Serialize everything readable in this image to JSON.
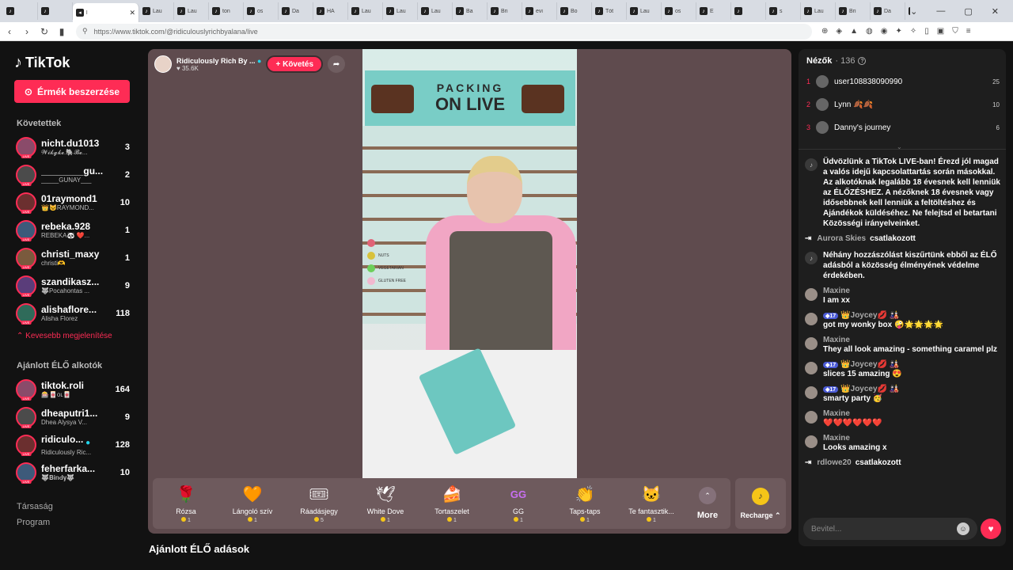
{
  "browser": {
    "tabs": [
      {
        "title": "",
        "icon": "tiktok-icon"
      },
      {
        "title": "",
        "icon": "tiktok-icon"
      },
      {
        "title": "l",
        "icon": "speaker-icon",
        "active": true
      },
      {
        "title": "Lau",
        "icon": "tiktok-icon"
      },
      {
        "title": "Lau",
        "icon": "tiktok-icon"
      },
      {
        "title": "ton",
        "icon": "tiktok-icon"
      },
      {
        "title": "os",
        "icon": "tiktok-icon"
      },
      {
        "title": "Da",
        "icon": "tiktok-icon"
      },
      {
        "title": "HA",
        "icon": "tiktok-icon"
      },
      {
        "title": "Lau",
        "icon": "tiktok-icon"
      },
      {
        "title": "Lau",
        "icon": "tiktok-icon"
      },
      {
        "title": "Lau",
        "icon": "tiktok-icon"
      },
      {
        "title": "Ba",
        "icon": "tiktok-icon"
      },
      {
        "title": "Bri",
        "icon": "tiktok-icon"
      },
      {
        "title": "evi",
        "icon": "tiktok-icon"
      },
      {
        "title": "Bo",
        "icon": "tiktok-icon"
      },
      {
        "title": "Tót",
        "icon": "tiktok-icon"
      },
      {
        "title": "Lau",
        "icon": "tiktok-icon"
      },
      {
        "title": "os",
        "icon": "tiktok-icon"
      },
      {
        "title": "E",
        "icon": "tiktok-icon"
      },
      {
        "title": "",
        "icon": "tiktok-icon"
      },
      {
        "title": "s",
        "icon": "tiktok-icon"
      },
      {
        "title": "Lau",
        "icon": "tiktok-icon"
      },
      {
        "title": "Bri",
        "icon": "tiktok-icon"
      },
      {
        "title": "Da",
        "icon": "tiktok-icon"
      },
      {
        "title": "net",
        "icon": "tiktok-icon"
      }
    ],
    "url": "https://www.tiktok.com/@ridiculouslyrichbyalana/live"
  },
  "sidebar": {
    "logo": "TikTok",
    "coins_button": "Érmék beszerzése",
    "following_title": "Követettek",
    "following": [
      {
        "name": "nicht.du1013",
        "sub": "𝓦𝓲𝓴𝓰𝓴𝓮.🐘𝓑𝓮...",
        "count": "3"
      },
      {
        "name": "________gu...",
        "sub": "_____GUNAY___",
        "count": "2"
      },
      {
        "name": "01raymond1",
        "sub": "👑😺RAYMOND...",
        "count": "10"
      },
      {
        "name": "rebeka.928",
        "sub": "REBEKA🐼 ❤️...",
        "count": "1"
      },
      {
        "name": "christi_maxy",
        "sub": "christi🫶",
        "count": "1"
      },
      {
        "name": "szandikasz...",
        "sub": "🐺Pocahontas ...",
        "count": "9"
      },
      {
        "name": "alishaflore...",
        "sub": "Alisha Florez",
        "count": "118"
      }
    ],
    "show_less": "Kevesebb megjelenítése",
    "recommended_title": "Ajánlott ÉLŐ alkotók",
    "recommended": [
      {
        "name": "tiktok.roli",
        "sub": "🎰🀄ᴏʟ🀄",
        "count": "164"
      },
      {
        "name": "dheaputri1...",
        "sub": "Dhea Alysya V...",
        "count": "9"
      },
      {
        "name": "ridiculo...",
        "sub": "Ridiculously Ric...",
        "count": "128",
        "verified": true
      },
      {
        "name": "feherfarka...",
        "sub": "🐺𝐁𝐢𝐧𝐝𝐲🐺",
        "count": "10"
      }
    ],
    "footer_links": [
      "Társaság",
      "Program"
    ]
  },
  "player": {
    "host_name": "Ridiculously Rich By ...",
    "host_likes": "35.6K",
    "follow_label": "+ Követés",
    "video_banner_line1": "PACKING",
    "video_banner_line2": "ON LIVE",
    "allergens": [
      "NUTS",
      "VEGETARIAN",
      "GLUTEN FREE"
    ],
    "gifts": [
      {
        "name": "Rózsa",
        "price": "1",
        "icon": "rose-icon",
        "glyph": "🌹"
      },
      {
        "name": "Lángoló szív",
        "price": "1",
        "icon": "heart-icon",
        "glyph": "🧡"
      },
      {
        "name": "Ráadásjegy",
        "price": "5",
        "icon": "ticket-icon",
        "glyph": "🎟"
      },
      {
        "name": "White Dove",
        "price": "1",
        "icon": "dove-icon",
        "glyph": "🕊"
      },
      {
        "name": "Tortaszelet",
        "price": "1",
        "icon": "cake-icon",
        "glyph": "🍰"
      },
      {
        "name": "GG",
        "price": "1",
        "icon": "gg-icon",
        "glyph": "GG"
      },
      {
        "name": "Taps-taps",
        "price": "1",
        "icon": "clap-icon",
        "glyph": "👏"
      },
      {
        "name": "Te fantasztik...",
        "price": "1",
        "icon": "cat-icon",
        "glyph": "🐱"
      }
    ],
    "more_label": "More",
    "recharge_label": "Recharge"
  },
  "below_title": "Ajánlott ÉLŐ adások",
  "right": {
    "viewers_label": "Nézők",
    "viewers_count": "· 136",
    "top_viewers": [
      {
        "rank": "1",
        "name": "user108838090990",
        "score": "25"
      },
      {
        "rank": "2",
        "name": "Lynn 🍂🍂",
        "score": "10"
      },
      {
        "rank": "3",
        "name": "Danny's journey",
        "score": "6"
      }
    ],
    "chat": [
      {
        "type": "system",
        "text": "Üdvözlünk a TikTok LIVE-ban! Érezd jól magad a valós idejű kapcsolattartás során másokkal. Az alkotóknak legalább 18 évesnek kell lenniük az ÉLŐZÉSHEZ. A nézőknek 18 évesnek vagy idősebbnek kell lenniük a feltöltéshez és Ajándékok küldéséhez. Ne felejtsd el betartani Közösségi irányelveinket."
      },
      {
        "type": "join",
        "user": "Aurora Skies",
        "text": "csatlakozott"
      },
      {
        "type": "system",
        "text": "Néhány hozzászólást kiszűrtünk ebből az ÉLŐ adásból a közösség élményének védelme érdekében."
      },
      {
        "type": "msg",
        "user": "Maxine",
        "level": "",
        "text": "I am xx"
      },
      {
        "type": "msg",
        "user": "👑Joycey💋 🎎",
        "level": "17",
        "text": "got my wonky box 🤪🌟🌟🌟🌟"
      },
      {
        "type": "msg",
        "user": "Maxine",
        "level": "",
        "text": "They all look amazing - something caramel plz"
      },
      {
        "type": "msg",
        "user": "👑Joycey💋 🎎",
        "level": "17",
        "text": "slices 15 amazing 😍"
      },
      {
        "type": "msg",
        "user": "👑Joycey💋 🎎",
        "level": "17",
        "text": "smarty party 🥳"
      },
      {
        "type": "msg",
        "user": "Maxine",
        "level": "",
        "text": "❤️❤️❤️❤️❤️❤️"
      },
      {
        "type": "msg",
        "user": "Maxine",
        "level": "",
        "text": "Looks amazing x"
      },
      {
        "type": "join",
        "user": "rdlowe20",
        "text": "csatlakozott"
      }
    ],
    "input_placeholder": "Bevitel..."
  }
}
